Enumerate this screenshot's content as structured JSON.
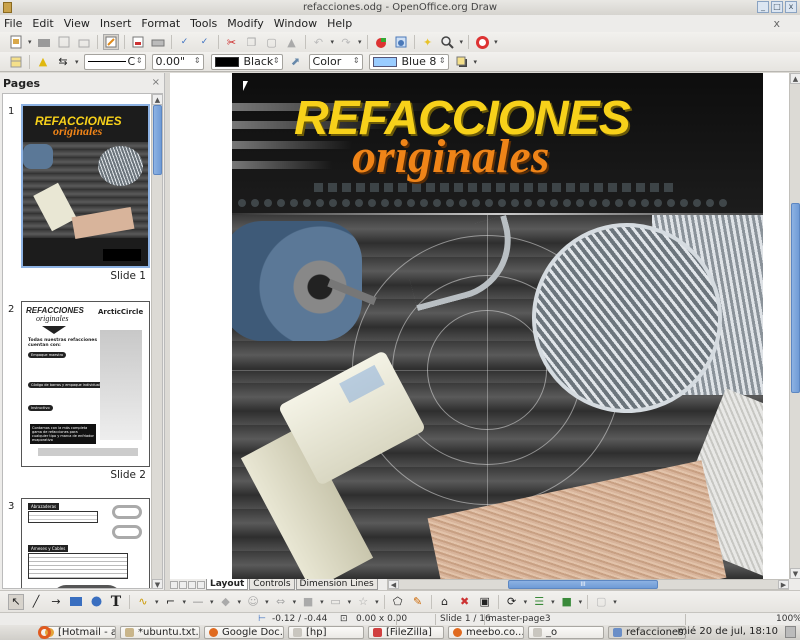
{
  "window": {
    "title": "refacciones.odg - OpenOffice.org Draw",
    "buttons": [
      "minimize",
      "maximize",
      "close"
    ]
  },
  "menubar": {
    "items": [
      "File",
      "Edit",
      "View",
      "Insert",
      "Format",
      "Tools",
      "Modify",
      "Window",
      "Help"
    ],
    "close_doc": "x"
  },
  "standard_toolbar": {
    "icons": [
      "new-document-icon",
      "open-icon",
      "save-icon",
      "export-icon",
      "edit-file-icon",
      "export-pdf-icon",
      "print-icon",
      "spellcheck-icon",
      "autospellcheck-icon",
      "cut-icon",
      "copy-icon",
      "paste-icon",
      "clone-format-icon",
      "undo-icon",
      "redo-icon",
      "chart-icon",
      "navigator-icon",
      "effects-icon",
      "zoom-icon",
      "help-icon"
    ]
  },
  "line_fill_toolbar": {
    "line_style": "C",
    "line_width": "0.00\"",
    "line_color": {
      "label": "Black",
      "hex": "#000000"
    },
    "area_style": "Color",
    "area_color": {
      "label": "Blue 8",
      "hex": "#99ccff"
    }
  },
  "pages_panel": {
    "title": "Pages",
    "close": "×",
    "scroll_position": 0.12,
    "slides": [
      {
        "number": "1",
        "label": "Slide 1",
        "selected": true
      },
      {
        "number": "2",
        "label": "Slide 2",
        "selected": false
      },
      {
        "number": "3",
        "label": "",
        "selected": false
      }
    ],
    "slide2_thumb": {
      "title": "REFACCIONES",
      "subtitle": "originales",
      "brand": "ArcticCircle",
      "heading": "Todas nuestras refacciones cuentan con:",
      "sections": [
        "Empaque maestro",
        "Código de barras y empaque individual",
        "Instructivo"
      ],
      "callout": "Contamos con la más completa gama de refacciones para cualquier tipo y marca de enfriador evaporativo"
    },
    "slide3_thumb": {
      "sections": [
        "Abrazaderas",
        "Arneses y Cables"
      ]
    }
  },
  "slide": {
    "title": "REFACCIONES",
    "subtitle": "originales",
    "colors": {
      "title": "#f7d11a",
      "subtitle": "#ef8418"
    }
  },
  "layer_tabs": [
    "Layout",
    "Controls",
    "Dimension Lines"
  ],
  "active_layer_tab": "Layout",
  "drawing_toolbar": {
    "icons": [
      "select-icon",
      "line-icon",
      "arrow-line-icon",
      "rectangle-icon",
      "ellipse-icon",
      "text-icon",
      "curve-icon",
      "connector-icon",
      "lines-arrows-icon",
      "basic-shapes-icon",
      "symbol-shapes-icon",
      "block-arrows-icon",
      "flowchart-icon",
      "callouts-icon",
      "stars-icon",
      "points-icon",
      "glue-points-icon",
      "fontwork-icon",
      "from-file-icon",
      "gallery-icon",
      "rotate-icon",
      "align-icon",
      "arrange-icon",
      "shadow-icon"
    ]
  },
  "status": {
    "position": "-0.12 / -0.44",
    "size": "0.00 x 0.00",
    "slide": "Slide 1 / 16",
    "master": "master-page3",
    "zoom": "100%"
  },
  "taskbar": {
    "tasks": [
      {
        "label": "[Hotmail - a...",
        "color": "#e3a43a"
      },
      {
        "label": "*ubuntu.txt...",
        "color": "#c9b58a"
      },
      {
        "label": "Google Doc...",
        "color": "#e06a1f"
      },
      {
        "label": "[hp]",
        "color": "#c9c6bf"
      },
      {
        "label": "[FileZilla]",
        "color": "#d04040"
      },
      {
        "label": "meebo.co...",
        "color": "#e06a1f"
      },
      {
        "label": "_o",
        "color": "#c9c6bf"
      },
      {
        "label": "refacciones...",
        "color": "#6a8ec7",
        "active": true
      }
    ],
    "clock": "mié 20 de jul, 18:10"
  }
}
